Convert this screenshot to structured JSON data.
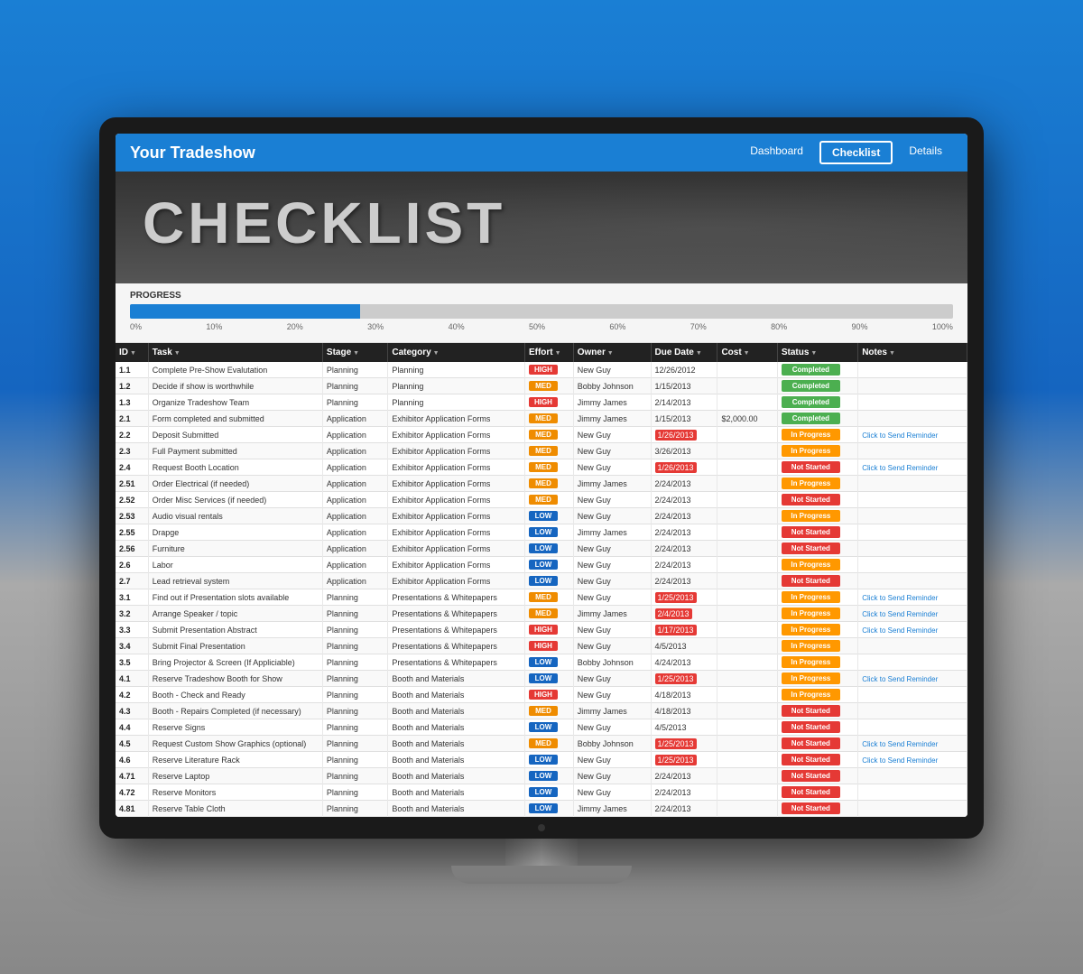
{
  "nav": {
    "logo": "Your Tradeshow",
    "links": [
      {
        "label": "Dashboard",
        "active": false
      },
      {
        "label": "Checklist",
        "active": true
      },
      {
        "label": "Details",
        "active": false
      }
    ]
  },
  "header": {
    "title": "CHECKLIST"
  },
  "progress": {
    "label": "PROGRESS",
    "fill_percent": 28,
    "markers": [
      "0%",
      "10%",
      "20%",
      "30%",
      "40%",
      "50%",
      "60%",
      "70%",
      "80%",
      "90%",
      "100%"
    ]
  },
  "table": {
    "columns": [
      "ID",
      "Task",
      "Stage",
      "Category",
      "Effort",
      "Owner",
      "Due Date",
      "Cost",
      "Status",
      "Notes"
    ],
    "rows": [
      {
        "id": "1.1",
        "task": "Complete Pre-Show Evalutation",
        "stage": "Planning",
        "category": "Planning",
        "effort": "HIGH",
        "owner": "New Guy",
        "duedate": "12/26/2012",
        "cost": "",
        "status": "Completed",
        "note": ""
      },
      {
        "id": "1.2",
        "task": "Decide if show is worthwhile",
        "stage": "Planning",
        "category": "Planning",
        "effort": "MED",
        "owner": "Bobby Johnson",
        "duedate": "1/15/2013",
        "cost": "",
        "status": "Completed",
        "note": ""
      },
      {
        "id": "1.3",
        "task": "Organize Tradeshow Team",
        "stage": "Planning",
        "category": "Planning",
        "effort": "HIGH",
        "owner": "Jimmy James",
        "duedate": "2/14/2013",
        "cost": "",
        "status": "Completed",
        "note": ""
      },
      {
        "id": "2.1",
        "task": "Form completed and submitted",
        "stage": "Application",
        "category": "Exhibitor Application Forms",
        "effort": "MED",
        "owner": "Jimmy James",
        "duedate": "1/15/2013",
        "cost": "$2,000.00",
        "status": "Completed",
        "note": ""
      },
      {
        "id": "2.2",
        "task": "Deposit Submitted",
        "stage": "Application",
        "category": "Exhibitor Application Forms",
        "effort": "MED",
        "owner": "New Guy",
        "duedate": "1/26/2013",
        "cost": "",
        "status": "In Progress",
        "note": "Click to Send Reminder"
      },
      {
        "id": "2.3",
        "task": "Full Payment submitted",
        "stage": "Application",
        "category": "Exhibitor Application Forms",
        "effort": "MED",
        "owner": "New Guy",
        "duedate": "3/26/2013",
        "cost": "",
        "status": "In Progress",
        "note": ""
      },
      {
        "id": "2.4",
        "task": "Request Booth Location",
        "stage": "Application",
        "category": "Exhibitor Application Forms",
        "effort": "MED",
        "owner": "New Guy",
        "duedate": "1/26/2013",
        "cost": "",
        "status": "Not Started",
        "note": "Click to Send Reminder"
      },
      {
        "id": "2.51",
        "task": "Order Electrical (if needed)",
        "stage": "Application",
        "category": "Exhibitor Application Forms",
        "effort": "MED",
        "owner": "Jimmy James",
        "duedate": "2/24/2013",
        "cost": "",
        "status": "In Progress",
        "note": ""
      },
      {
        "id": "2.52",
        "task": "Order Misc Services (if needed)",
        "stage": "Application",
        "category": "Exhibitor Application Forms",
        "effort": "MED",
        "owner": "New Guy",
        "duedate": "2/24/2013",
        "cost": "",
        "status": "Not Started",
        "note": ""
      },
      {
        "id": "2.53",
        "task": "Audio visual rentals",
        "stage": "Application",
        "category": "Exhibitor Application Forms",
        "effort": "LOW",
        "owner": "New Guy",
        "duedate": "2/24/2013",
        "cost": "",
        "status": "In Progress",
        "note": ""
      },
      {
        "id": "2.55",
        "task": "Drapge",
        "stage": "Application",
        "category": "Exhibitor Application Forms",
        "effort": "LOW",
        "owner": "Jimmy James",
        "duedate": "2/24/2013",
        "cost": "",
        "status": "Not Started",
        "note": ""
      },
      {
        "id": "2.56",
        "task": "Furniture",
        "stage": "Application",
        "category": "Exhibitor Application Forms",
        "effort": "LOW",
        "owner": "New Guy",
        "duedate": "2/24/2013",
        "cost": "",
        "status": "Not Started",
        "note": ""
      },
      {
        "id": "2.6",
        "task": "Labor",
        "stage": "Application",
        "category": "Exhibitor Application Forms",
        "effort": "LOW",
        "owner": "New Guy",
        "duedate": "2/24/2013",
        "cost": "",
        "status": "In Progress",
        "note": ""
      },
      {
        "id": "2.7",
        "task": "Lead retrieval system",
        "stage": "Application",
        "category": "Exhibitor Application Forms",
        "effort": "LOW",
        "owner": "New Guy",
        "duedate": "2/24/2013",
        "cost": "",
        "status": "Not Started",
        "note": ""
      },
      {
        "id": "3.1",
        "task": "Find out if Presentation slots available",
        "stage": "Planning",
        "category": "Presentations & Whitepapers",
        "effort": "MED",
        "owner": "New Guy",
        "duedate": "1/25/2013",
        "cost": "",
        "status": "In Progress",
        "note": "Click to Send Reminder"
      },
      {
        "id": "3.2",
        "task": "Arrange Speaker / topic",
        "stage": "Planning",
        "category": "Presentations & Whitepapers",
        "effort": "MED",
        "owner": "Jimmy James",
        "duedate": "2/4/2013",
        "cost": "",
        "status": "In Progress",
        "note": "Click to Send Reminder"
      },
      {
        "id": "3.3",
        "task": "Submit Presentation Abstract",
        "stage": "Planning",
        "category": "Presentations & Whitepapers",
        "effort": "HIGH",
        "owner": "New Guy",
        "duedate": "1/17/2013",
        "cost": "",
        "status": "In Progress",
        "note": "Click to Send Reminder"
      },
      {
        "id": "3.4",
        "task": "Submit Final Presentation",
        "stage": "Planning",
        "category": "Presentations & Whitepapers",
        "effort": "HIGH",
        "owner": "New Guy",
        "duedate": "4/5/2013",
        "cost": "",
        "status": "In Progress",
        "note": ""
      },
      {
        "id": "3.5",
        "task": "Bring Projector & Screen (If Appliciable)",
        "stage": "Planning",
        "category": "Presentations & Whitepapers",
        "effort": "LOW",
        "owner": "Bobby Johnson",
        "duedate": "4/24/2013",
        "cost": "",
        "status": "In Progress",
        "note": ""
      },
      {
        "id": "4.1",
        "task": "Reserve Tradeshow Booth for Show",
        "stage": "Planning",
        "category": "Booth and Materials",
        "effort": "LOW",
        "owner": "New Guy",
        "duedate": "1/25/2013",
        "cost": "",
        "status": "In Progress",
        "note": "Click to Send Reminder"
      },
      {
        "id": "4.2",
        "task": "Booth - Check and Ready",
        "stage": "Planning",
        "category": "Booth and Materials",
        "effort": "HIGH",
        "owner": "New Guy",
        "duedate": "4/18/2013",
        "cost": "",
        "status": "In Progress",
        "note": ""
      },
      {
        "id": "4.3",
        "task": "Booth - Repairs Completed (if necessary)",
        "stage": "Planning",
        "category": "Booth and Materials",
        "effort": "MED",
        "owner": "Jimmy James",
        "duedate": "4/18/2013",
        "cost": "",
        "status": "Not Started",
        "note": ""
      },
      {
        "id": "4.4",
        "task": "Reserve Signs",
        "stage": "Planning",
        "category": "Booth and Materials",
        "effort": "LOW",
        "owner": "New Guy",
        "duedate": "4/5/2013",
        "cost": "",
        "status": "Not Started",
        "note": ""
      },
      {
        "id": "4.5",
        "task": "Request Custom Show Graphics (optional)",
        "stage": "Planning",
        "category": "Booth and Materials",
        "effort": "MED",
        "owner": "Bobby Johnson",
        "duedate": "1/25/2013",
        "cost": "",
        "status": "Not Started",
        "note": "Click to Send Reminder"
      },
      {
        "id": "4.6",
        "task": "Reserve Literature Rack",
        "stage": "Planning",
        "category": "Booth and Materials",
        "effort": "LOW",
        "owner": "New Guy",
        "duedate": "1/25/2013",
        "cost": "",
        "status": "Not Started",
        "note": "Click to Send Reminder"
      },
      {
        "id": "4.71",
        "task": "Reserve Laptop",
        "stage": "Planning",
        "category": "Booth and Materials",
        "effort": "LOW",
        "owner": "New Guy",
        "duedate": "2/24/2013",
        "cost": "",
        "status": "Not Started",
        "note": ""
      },
      {
        "id": "4.72",
        "task": "Reserve Monitors",
        "stage": "Planning",
        "category": "Booth and Materials",
        "effort": "LOW",
        "owner": "New Guy",
        "duedate": "2/24/2013",
        "cost": "",
        "status": "Not Started",
        "note": ""
      },
      {
        "id": "4.81",
        "task": "Reserve Table Cloth",
        "stage": "Planning",
        "category": "Booth and Materials",
        "effort": "LOW",
        "owner": "Jimmy James",
        "duedate": "2/24/2013",
        "cost": "",
        "status": "Not Started",
        "note": ""
      }
    ]
  }
}
